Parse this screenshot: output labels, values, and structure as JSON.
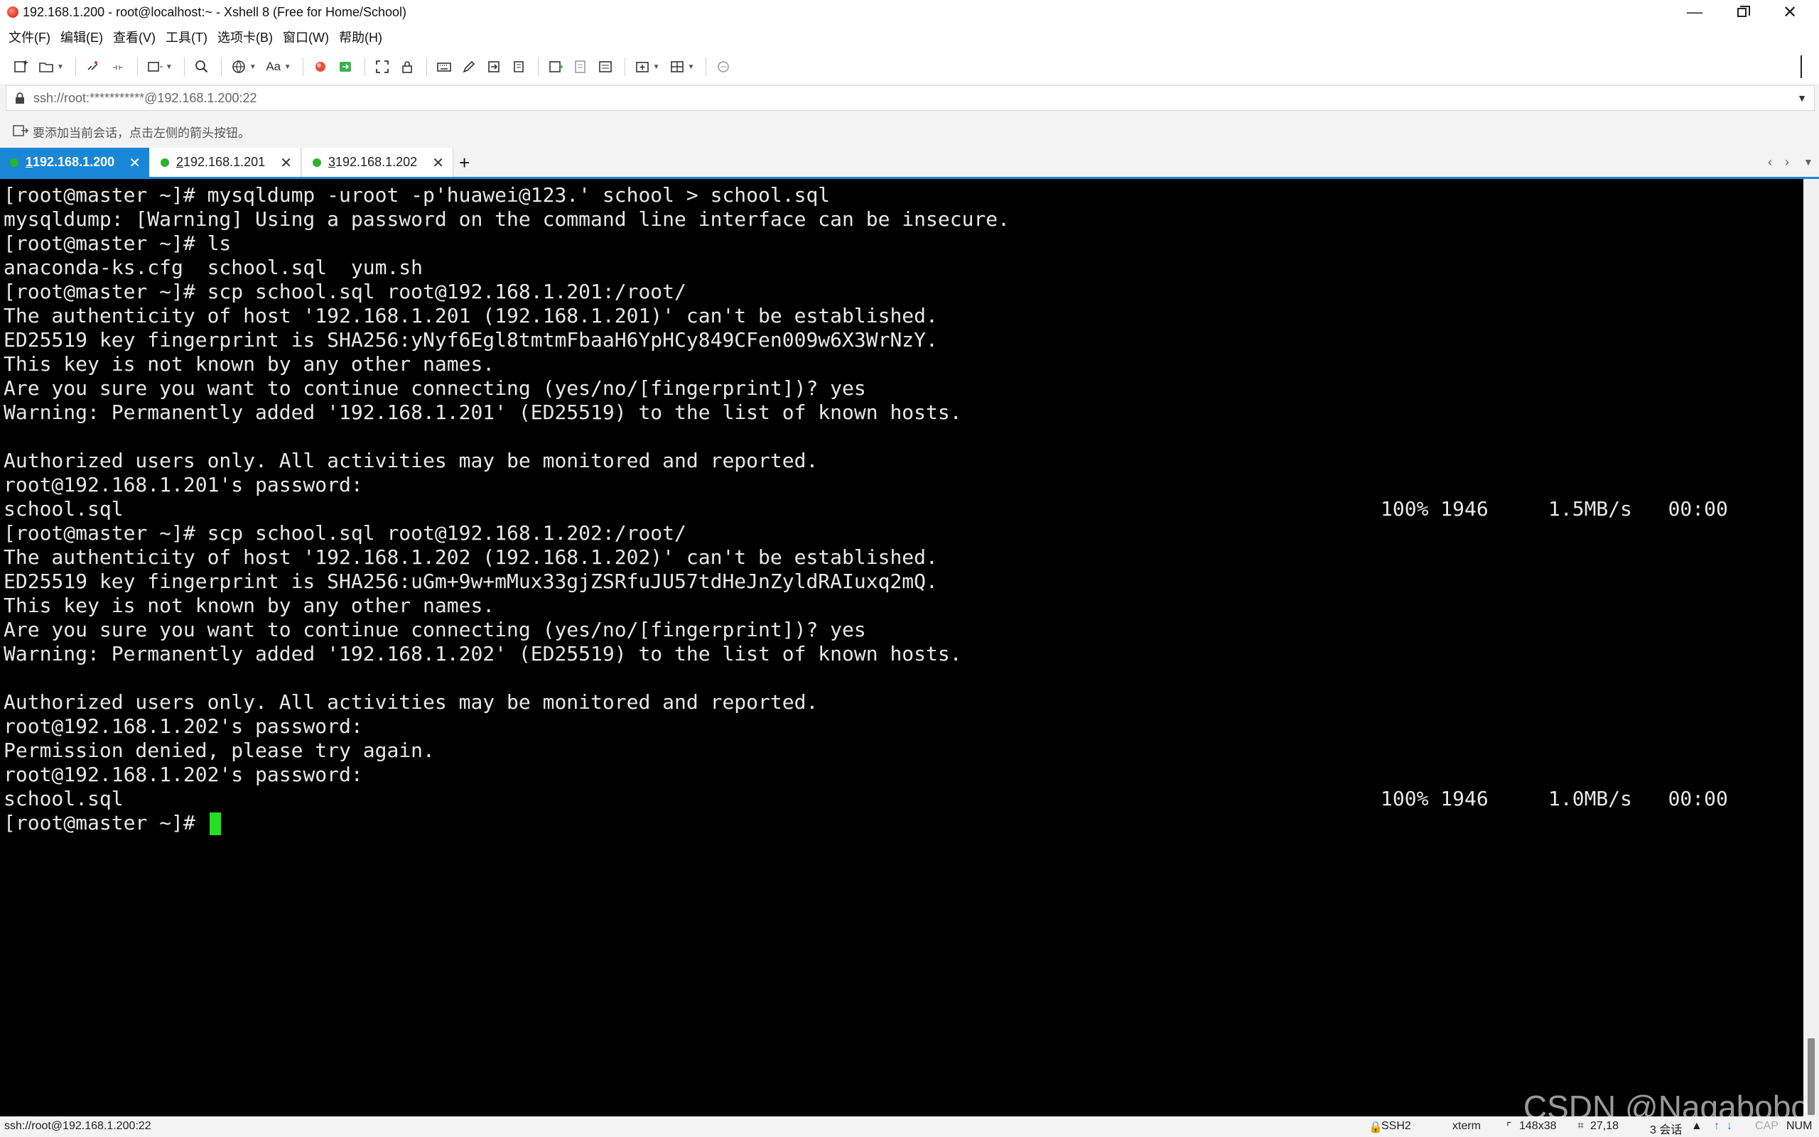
{
  "window": {
    "title": "192.168.1.200 - root@localhost:~ - Xshell 8 (Free for Home/School)"
  },
  "menu": [
    "文件(F)",
    "编辑(E)",
    "查看(V)",
    "工具(T)",
    "选项卡(B)",
    "窗口(W)",
    "帮助(H)"
  ],
  "address": {
    "value": "ssh://root:***********@192.168.1.200:22"
  },
  "hint": "要添加当前会话，点击左侧的箭头按钮。",
  "tabs": [
    {
      "num": "1",
      "label": " 192.168.1.200",
      "active": true
    },
    {
      "num": "2",
      "label": " 192.168.1.201",
      "active": false
    },
    {
      "num": "3",
      "label": " 192.168.1.202",
      "active": false
    }
  ],
  "terminal": {
    "lines": [
      "[root@master ~]# mysqldump -uroot -p'huawei@123.' school > school.sql",
      "mysqldump: [Warning] Using a password on the command line interface can be insecure.",
      "[root@master ~]# ls",
      "anaconda-ks.cfg  school.sql  yum.sh",
      "[root@master ~]# scp school.sql root@192.168.1.201:/root/",
      "The authenticity of host '192.168.1.201 (192.168.1.201)' can't be established.",
      "ED25519 key fingerprint is SHA256:yNyf6Egl8tmtmFbaaH6YpHCy849CFen009w6X3WrNzY.",
      "This key is not known by any other names.",
      "Are you sure you want to continue connecting (yes/no/[fingerprint])? yes",
      "Warning: Permanently added '192.168.1.201' (ED25519) to the list of known hosts.",
      "",
      "Authorized users only. All activities may be monitored and reported.",
      "root@192.168.1.201's password: ",
      "school.sql",
      "[root@master ~]# scp school.sql root@192.168.1.202:/root/",
      "The authenticity of host '192.168.1.202 (192.168.1.202)' can't be established.",
      "ED25519 key fingerprint is SHA256:uGm+9w+mMux33gjZSRfuJU57tdHeJnZyldRAIuxq2mQ.",
      "This key is not known by any other names.",
      "Are you sure you want to continue connecting (yes/no/[fingerprint])? yes",
      "Warning: Permanently added '192.168.1.202' (ED25519) to the list of known hosts.",
      "",
      "Authorized users only. All activities may be monitored and reported.",
      "root@192.168.1.202's password: ",
      "Permission denied, please try again.",
      "root@192.168.1.202's password: ",
      "school.sql",
      "[root@master ~]# "
    ],
    "progress1": "100% 1946     1.5MB/s   00:00",
    "progress2": "100% 1946     1.0MB/s   00:00",
    "cursor_color": "#22e022",
    "background": "#000000"
  },
  "watermark": "CSDN @Nagabobo",
  "status": {
    "connection": "ssh://root@192.168.1.200:22",
    "protocol": "SSH2",
    "term": "xterm",
    "size": "148x38",
    "pos": "27,18",
    "sessions": "3 会话",
    "cap": "CAP",
    "num": "NUM"
  },
  "colors": {
    "accent": "#1a87d6",
    "connected": "#2bb42b"
  }
}
